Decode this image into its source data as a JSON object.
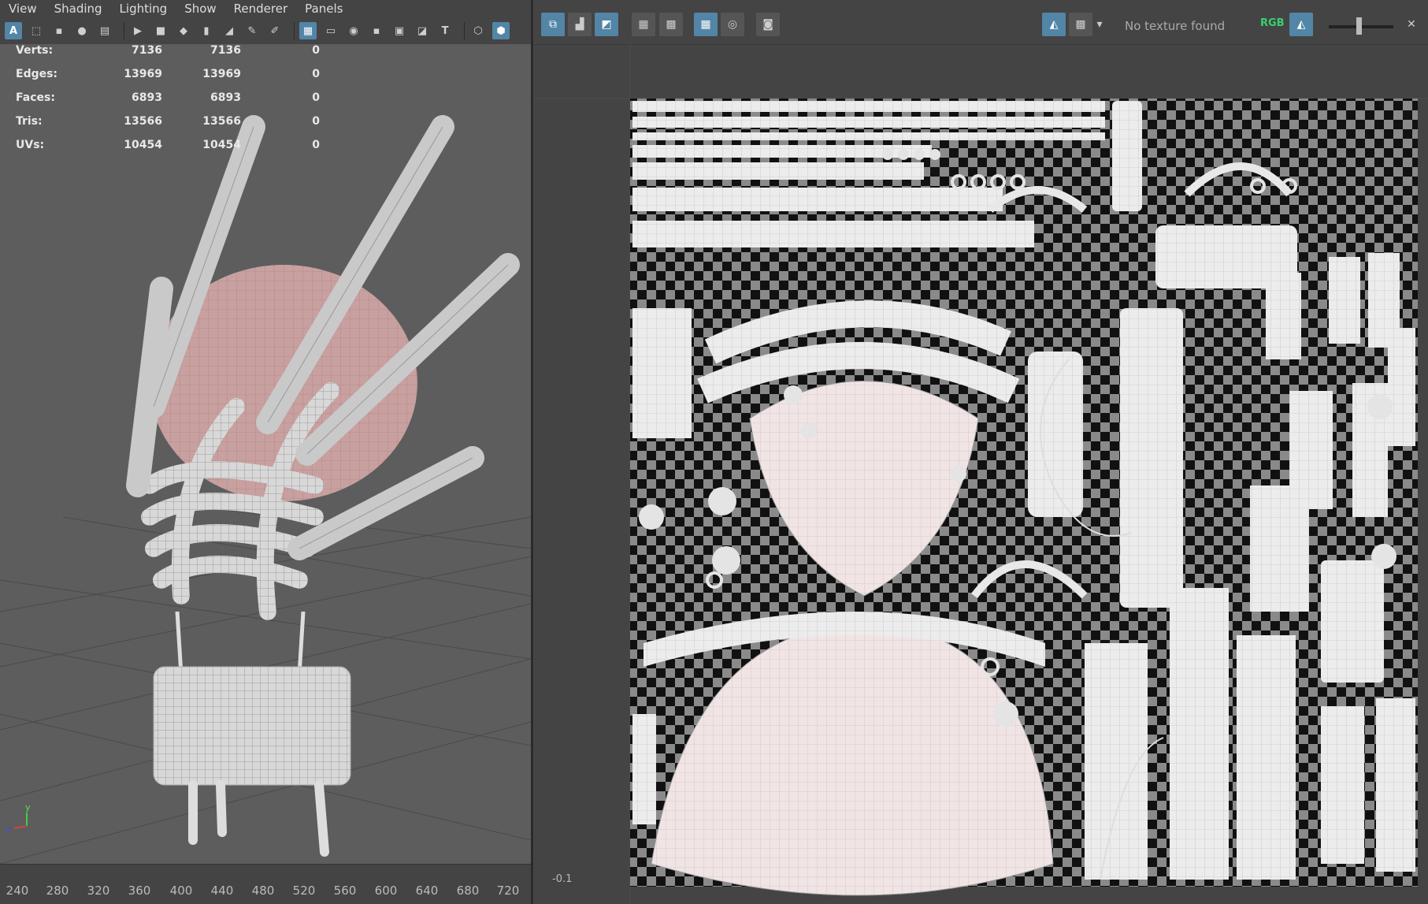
{
  "menu": [
    "View",
    "Shading",
    "Lighting",
    "Show",
    "Renderer",
    "Panels"
  ],
  "stats": [
    {
      "label": "Verts:",
      "v1": "7136",
      "v2": "7136",
      "v3": "0"
    },
    {
      "label": "Edges:",
      "v1": "13969",
      "v2": "13969",
      "v3": "0"
    },
    {
      "label": "Faces:",
      "v1": "6893",
      "v2": "6893",
      "v3": "0"
    },
    {
      "label": "Tris:",
      "v1": "13566",
      "v2": "13566",
      "v3": "0"
    },
    {
      "label": "UVs:",
      "v1": "10454",
      "v2": "10454",
      "v3": "0"
    }
  ],
  "ruler": [
    "240",
    "280",
    "320",
    "360",
    "400",
    "440",
    "480",
    "520",
    "560",
    "600",
    "640",
    "680",
    "720"
  ],
  "uv_editor": {
    "texture_status": "No texture found",
    "channel_label": "RGB",
    "axis_label": "-0.1"
  },
  "toolbar_left": {
    "select_label": "A"
  },
  "colors": {
    "accent": "#5285a6",
    "viewport": "#5d5d5d",
    "panel": "#444444"
  }
}
